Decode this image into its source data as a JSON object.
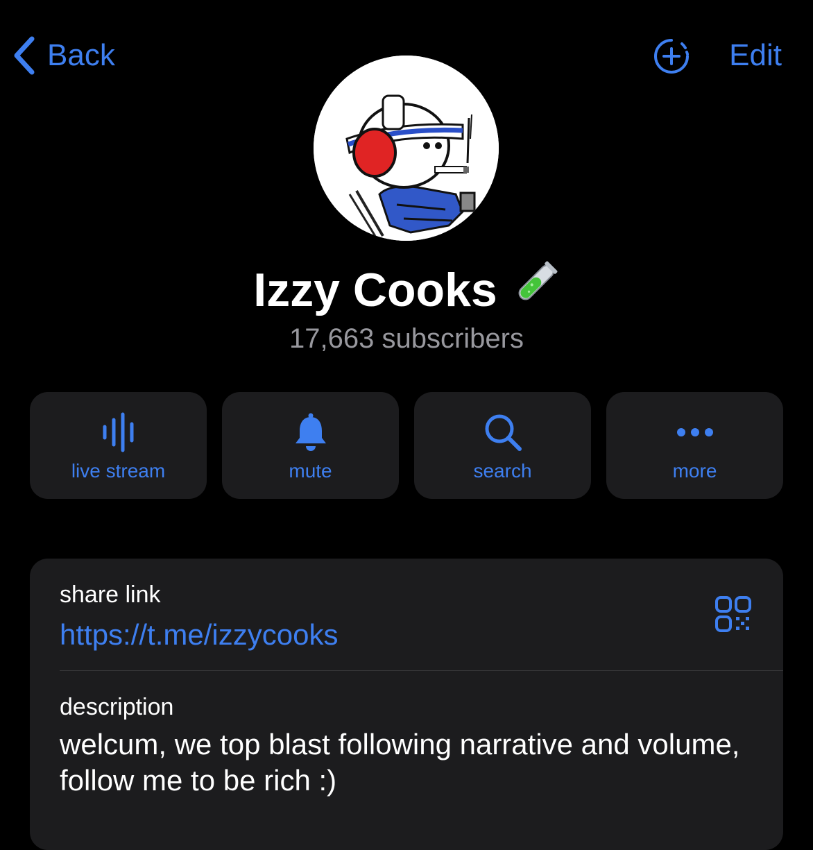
{
  "nav": {
    "back_label": "Back",
    "edit_label": "Edit",
    "icons": {
      "back": "chevron-left-icon",
      "add": "add-circle-icon"
    }
  },
  "channel": {
    "title": "Izzy Cooks",
    "title_emoji": "test-tube-icon",
    "subscribers": "17,663 subscribers"
  },
  "actions": [
    {
      "label": "live stream",
      "icon": "live-stream-icon"
    },
    {
      "label": "mute",
      "icon": "bell-icon"
    },
    {
      "label": "search",
      "icon": "search-icon"
    },
    {
      "label": "more",
      "icon": "more-icon"
    }
  ],
  "info": {
    "share_link_label": "share link",
    "share_link_value": "https://t.me/izzycooks",
    "description_label": "description",
    "description_value": "welcum, we top blast following narrative and volume, follow me to be rich :)"
  },
  "colors": {
    "background": "#000000",
    "accent": "#3e7ff0",
    "card": "#1c1c1e",
    "secondary_text": "#98989e",
    "divider": "#38383a"
  }
}
